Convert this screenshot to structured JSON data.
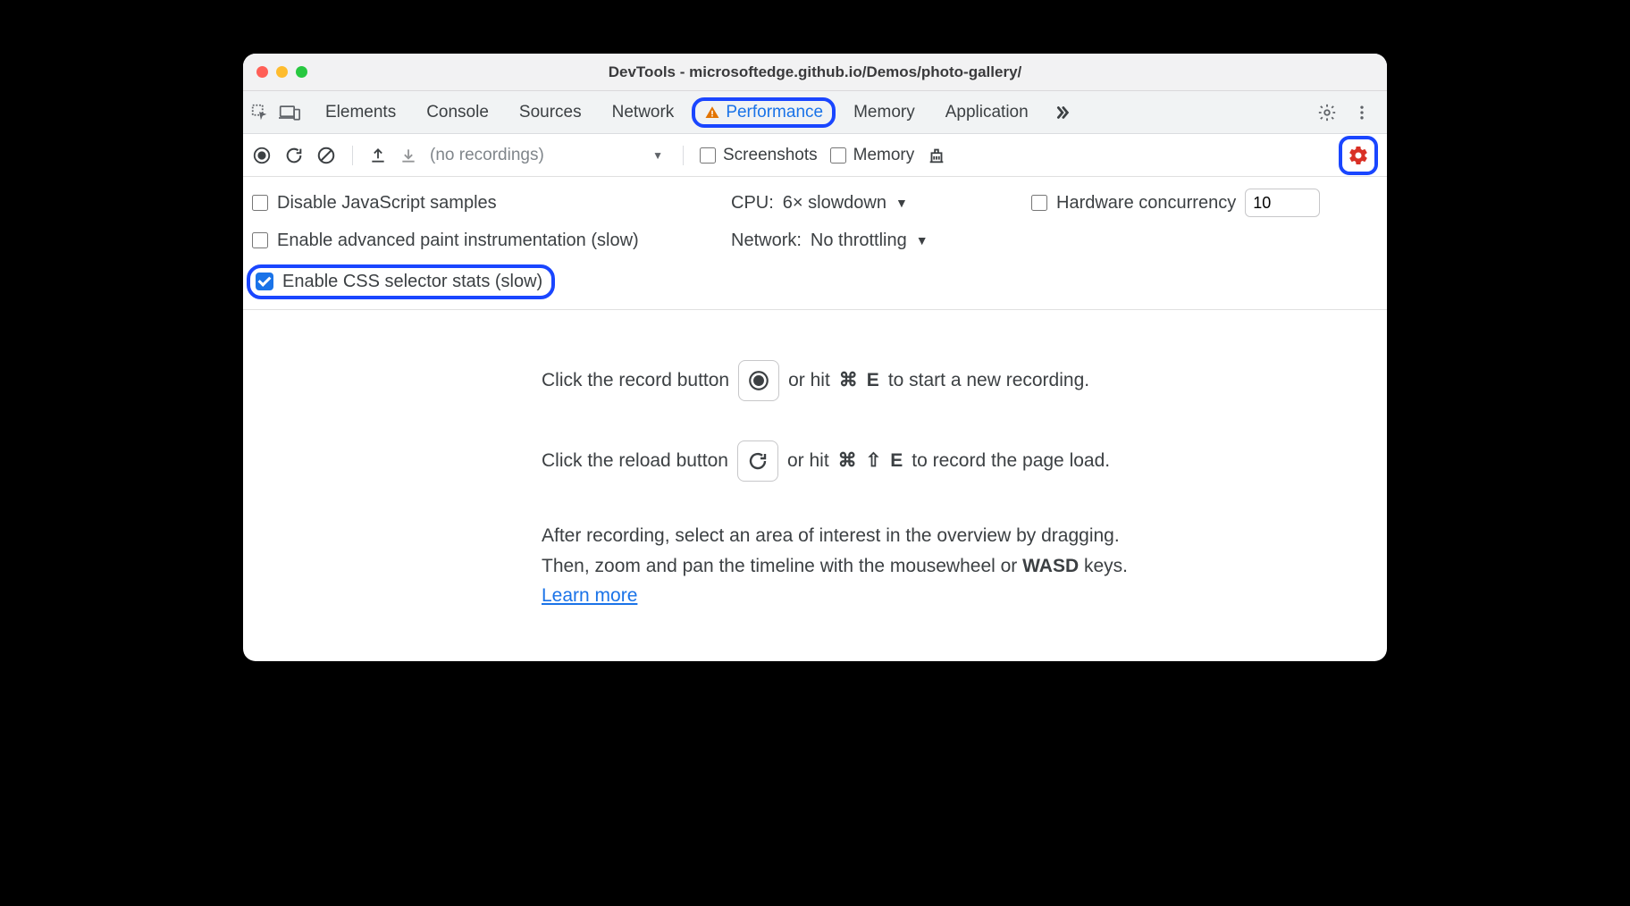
{
  "window": {
    "title": "DevTools - microsoftedge.github.io/Demos/photo-gallery/"
  },
  "tabs": {
    "elements": "Elements",
    "console": "Console",
    "sources": "Sources",
    "network": "Network",
    "performance": "Performance",
    "memory": "Memory",
    "application": "Application"
  },
  "toolbar": {
    "recordings_placeholder": "(no recordings)",
    "screenshots_label": "Screenshots",
    "memory_label": "Memory"
  },
  "settings": {
    "disable_js_label": "Disable JavaScript samples",
    "enable_paint_label": "Enable advanced paint instrumentation (slow)",
    "enable_css_label": "Enable CSS selector stats (slow)",
    "cpu_label": "CPU:",
    "cpu_value": "6× slowdown",
    "network_label": "Network:",
    "network_value": "No throttling",
    "hw_label": "Hardware concurrency",
    "hw_value": "10"
  },
  "hints": {
    "record_prefix": "Click the record button",
    "record_suffix_1": "or hit",
    "record_kbd1": "⌘",
    "record_kbd2": "E",
    "record_suffix_2": "to start a new recording.",
    "reload_prefix": "Click the reload button",
    "reload_suffix_1": "or hit",
    "reload_kbd1": "⌘",
    "reload_kbd2": "⇧",
    "reload_kbd3": "E",
    "reload_suffix_2": "to record the page load.",
    "para_line1": "After recording, select an area of interest in the overview by dragging.",
    "para_line2a": "Then, zoom and pan the timeline with the mousewheel or ",
    "para_wasd": "WASD",
    "para_line2b": " keys.",
    "learn_more": "Learn more"
  }
}
